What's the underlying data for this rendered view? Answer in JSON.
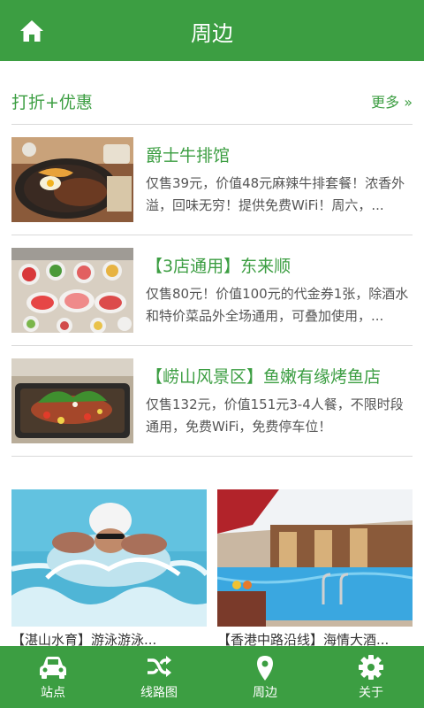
{
  "header": {
    "title": "周边",
    "home_icon": "home-icon"
  },
  "section": {
    "title": "打折+优惠",
    "more": "更多 »"
  },
  "deals": [
    {
      "name": "爵士牛排馆",
      "desc": "仅售39元，价值48元麻辣牛排套餐！浓香外溢，回味无穷！提供免费WiFi！周六，..."
    },
    {
      "name": "【3店通用】东来顺",
      "desc": "仅售80元！价值100元的代金券1张，除酒水和特价菜品外全场通用，可叠加使用，..."
    },
    {
      "name": "【崂山风景区】鱼嫩有缘烤鱼店",
      "desc": "仅售132元，价值151元3-4人餐，不限时段通用，免费WiFi，免费停车位！"
    }
  ],
  "promos": [
    {
      "caption": "【湛山水育】游泳游泳..."
    },
    {
      "caption": "【香港中路沿线】海情大酒..."
    }
  ],
  "nav": [
    {
      "label": "站点",
      "icon": "car-icon"
    },
    {
      "label": "线路图",
      "icon": "shuffle-icon"
    },
    {
      "label": "周边",
      "icon": "map-pin-icon"
    },
    {
      "label": "关于",
      "icon": "gear-icon"
    }
  ],
  "colors": {
    "brand": "#3c9e42"
  }
}
